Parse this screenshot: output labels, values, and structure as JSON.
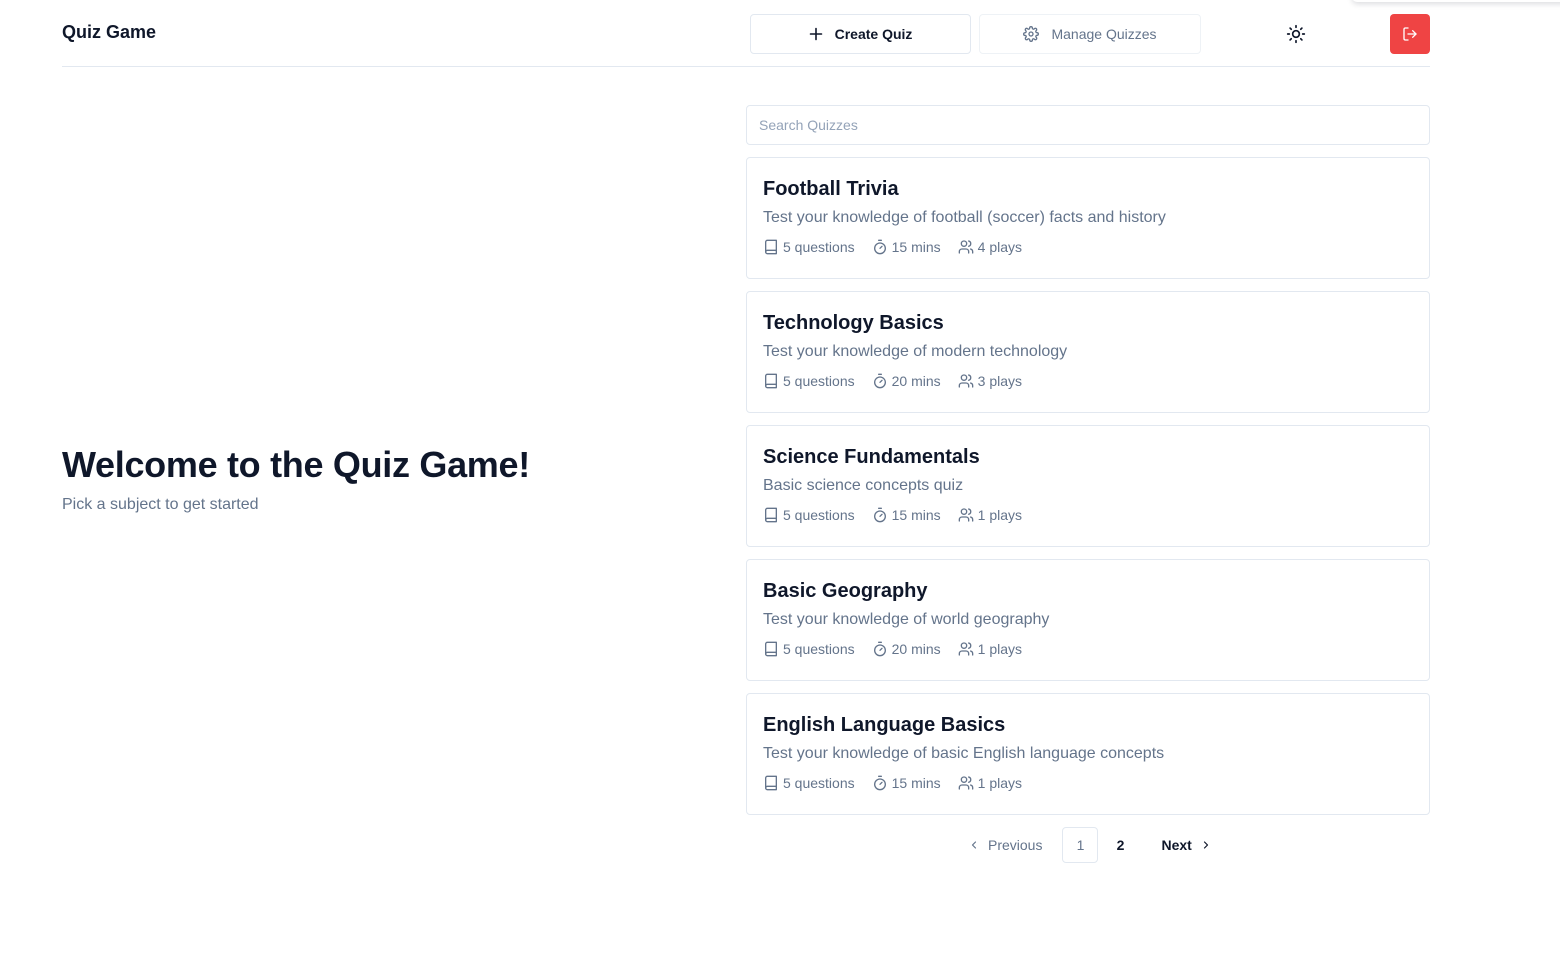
{
  "header": {
    "app_title": "Quiz Game",
    "create_label": "Create Quiz",
    "manage_label": "Manage Quizzes"
  },
  "hero": {
    "title": "Welcome to the Quiz Game!",
    "subtitle": "Pick a subject to get started"
  },
  "search": {
    "placeholder": "Search Quizzes",
    "value": ""
  },
  "quizzes": [
    {
      "title": "Football Trivia",
      "description": "Test your knowledge of football (soccer) facts and history",
      "questions": "5 questions",
      "duration": "15 mins",
      "plays": "4 plays"
    },
    {
      "title": "Technology Basics",
      "description": "Test your knowledge of modern technology",
      "questions": "5 questions",
      "duration": "20 mins",
      "plays": "3 plays"
    },
    {
      "title": "Science Fundamentals",
      "description": "Basic science concepts quiz",
      "questions": "5 questions",
      "duration": "15 mins",
      "plays": "1 plays"
    },
    {
      "title": "Basic Geography",
      "description": "Test your knowledge of world geography",
      "questions": "5 questions",
      "duration": "20 mins",
      "plays": "1 plays"
    },
    {
      "title": "English Language Basics",
      "description": "Test your knowledge of basic English language concepts",
      "questions": "5 questions",
      "duration": "15 mins",
      "plays": "1 plays"
    }
  ],
  "pagination": {
    "previous_label": "Previous",
    "pages": [
      "1",
      "2"
    ],
    "current_page": "1",
    "next_label": "Next"
  },
  "icons": {
    "create": "plus-icon",
    "manage": "gear-icon",
    "theme": "sun-icon",
    "logout": "logout-icon",
    "questions": "book-icon",
    "duration": "timer-icon",
    "plays": "users-icon"
  },
  "colors": {
    "logout_button": "#ef4444",
    "muted_text": "#64748b",
    "border": "#e2e8f0"
  }
}
